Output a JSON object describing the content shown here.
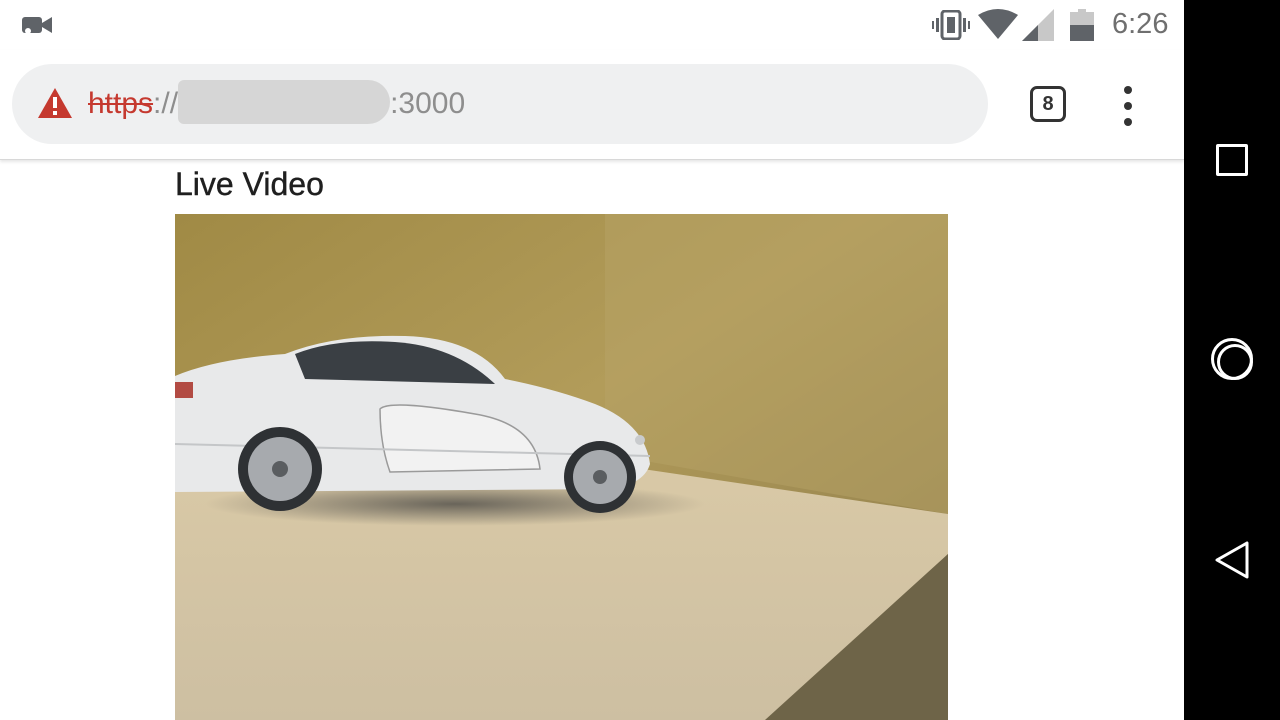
{
  "status_bar": {
    "time": "6:26",
    "icons": [
      "video-camera-icon",
      "vibrate-icon",
      "wifi-icon",
      "cellular-signal-icon",
      "battery-icon"
    ]
  },
  "browser": {
    "url_scheme": "https",
    "url_separator": "://",
    "url_port": ":3000",
    "tab_count": "8",
    "icons": [
      "security-warning-icon",
      "more-vert-icon"
    ],
    "warning_color": "#c5392f"
  },
  "page": {
    "heading": "Live Video",
    "video_alt": "Live video feed of a white toy car on a beige surface"
  },
  "nav_bar": {
    "icons": [
      "recents-icon",
      "home-icon",
      "back-icon"
    ]
  }
}
